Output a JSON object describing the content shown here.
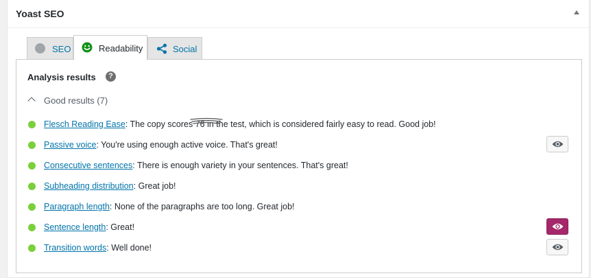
{
  "metabox": {
    "title": "Yoast SEO"
  },
  "tabs": [
    {
      "label": "SEO",
      "icon": "grey-dot-icon",
      "active": false
    },
    {
      "label": "Readability",
      "icon": "smiley-icon",
      "active": true
    },
    {
      "label": "Social",
      "icon": "share-icon",
      "active": false
    }
  ],
  "analysis": {
    "heading": "Analysis results",
    "help_icon_label": "?",
    "group_label": "Good results (7)",
    "results": [
      {
        "link": "Flesch Reading Ease",
        "text": ": The copy scores 76 in the test, which is considered fairly easy to read. Good job!",
        "eye": "none"
      },
      {
        "link": "Passive voice",
        "text": ": You're using enough active voice. That's great!",
        "eye": "inactive"
      },
      {
        "link": "Consecutive sentences",
        "text": ": There is enough variety in your sentences. That's great!",
        "eye": "none"
      },
      {
        "link": "Subheading distribution",
        "text": ": Great job!",
        "eye": "none"
      },
      {
        "link": "Paragraph length",
        "text": ": None of the paragraphs are too long. Great job!",
        "eye": "none"
      },
      {
        "link": "Sentence length",
        "text": ": Great!",
        "eye": "active"
      },
      {
        "link": "Transition words",
        "text": ": Well done!",
        "eye": "inactive"
      }
    ]
  },
  "colors": {
    "good_bullet": "#7ad03a",
    "link": "#0073aa",
    "eye_active": "#a4286a",
    "smiley": "#119216"
  }
}
